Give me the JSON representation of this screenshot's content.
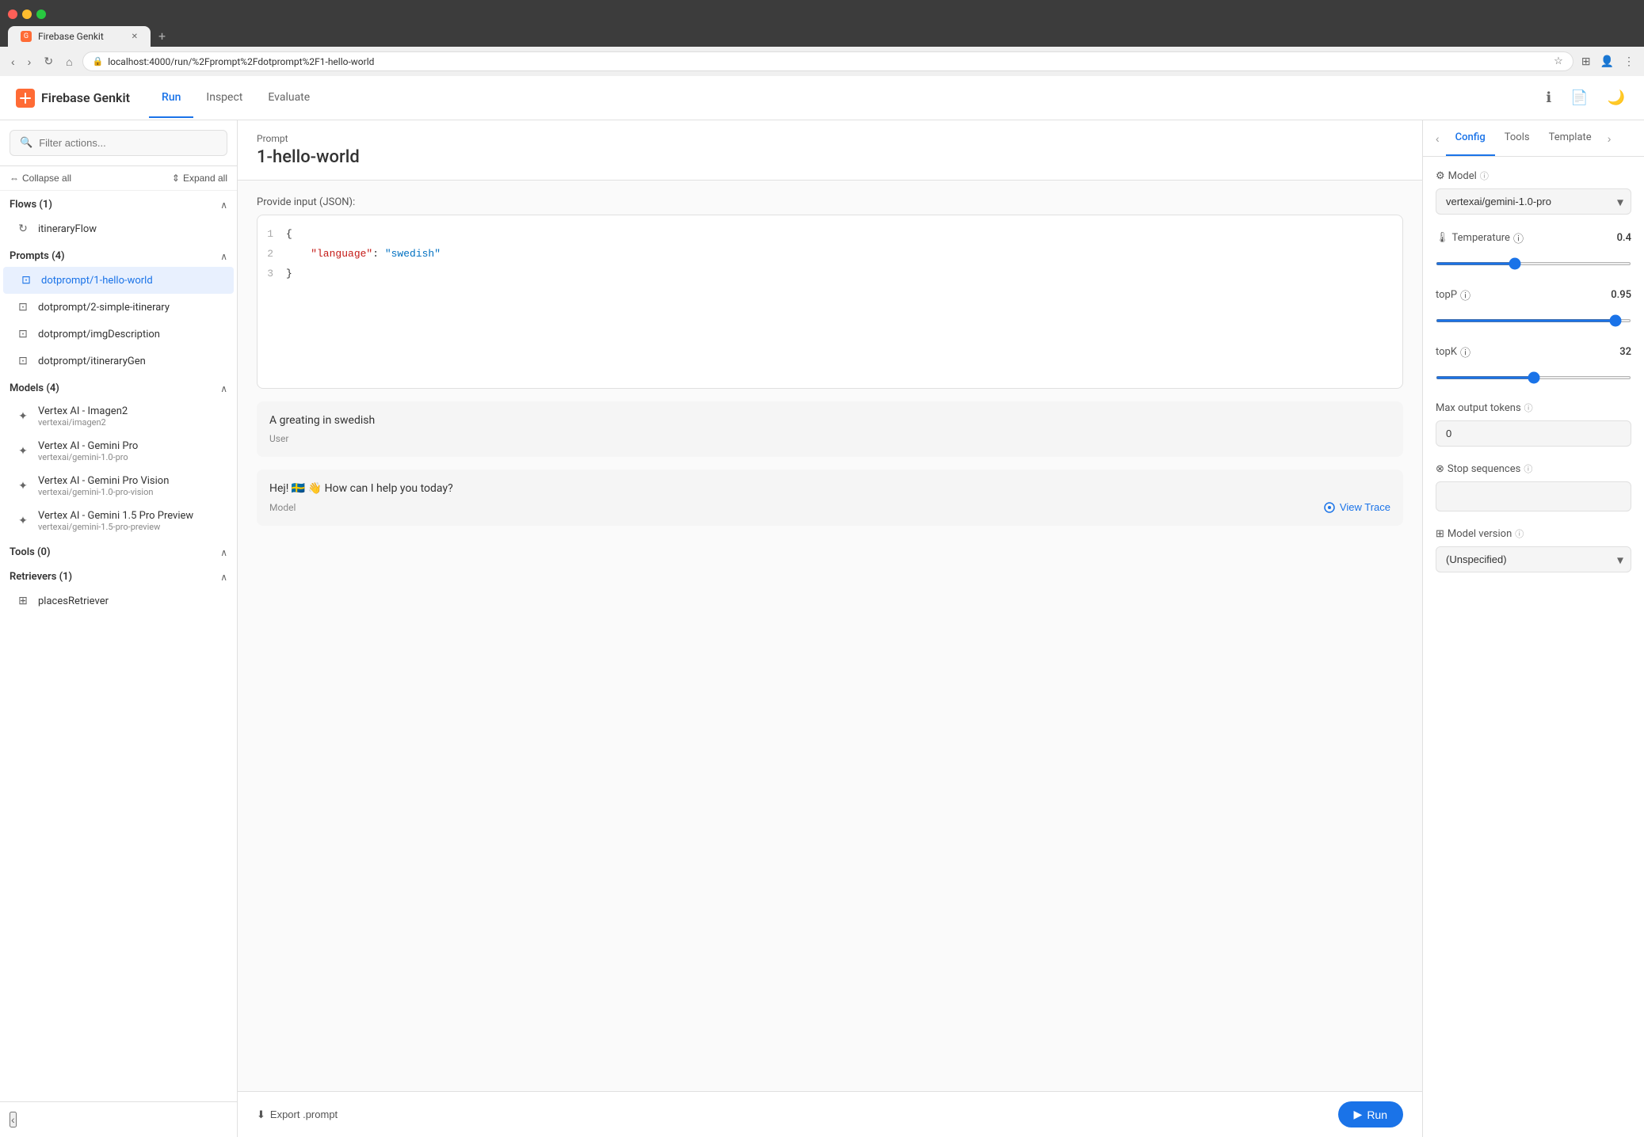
{
  "browser": {
    "tab_label": "Firebase Genkit",
    "tab_close": "✕",
    "tab_new": "+",
    "url": "localhost:4000/run/%2Fprompt%2Fdotprompt%2F1-hello-world",
    "nav_back": "‹",
    "nav_forward": "›",
    "nav_refresh": "↻",
    "nav_home": "⌂"
  },
  "header": {
    "logo_text": "Firebase Genkit",
    "nav_run": "Run",
    "nav_inspect": "Inspect",
    "nav_evaluate": "Evaluate"
  },
  "sidebar": {
    "search_placeholder": "Filter actions...",
    "collapse_all": "Collapse all",
    "expand_all": "Expand all",
    "sections": [
      {
        "title": "Flows (1)",
        "items": [
          {
            "label": "itineraryFlow",
            "icon": "flow"
          }
        ]
      },
      {
        "title": "Prompts (4)",
        "items": [
          {
            "label": "dotprompt/1-hello-world",
            "icon": "prompt",
            "active": true
          },
          {
            "label": "dotprompt/2-simple-itinerary",
            "icon": "prompt"
          },
          {
            "label": "dotprompt/imgDescription",
            "icon": "prompt"
          },
          {
            "label": "dotprompt/itineraryGen",
            "icon": "prompt"
          }
        ]
      },
      {
        "title": "Models (4)",
        "items": [
          {
            "label": "Vertex AI - Imagen2",
            "sublabel": "vertexai/imagen2",
            "icon": "model"
          },
          {
            "label": "Vertex AI - Gemini Pro",
            "sublabel": "vertexai/gemini-1.0-pro",
            "icon": "model"
          },
          {
            "label": "Vertex AI - Gemini Pro Vision",
            "sublabel": "vertexai/gemini-1.0-pro-vision",
            "icon": "model"
          },
          {
            "label": "Vertex AI - Gemini 1.5 Pro Preview",
            "sublabel": "vertexai/gemini-1.5-pro-preview",
            "icon": "model"
          }
        ]
      },
      {
        "title": "Tools (0)",
        "items": []
      },
      {
        "title": "Retrievers (1)",
        "items": [
          {
            "label": "placesRetriever",
            "icon": "retriever"
          }
        ]
      }
    ],
    "collapse_icon": "‹"
  },
  "prompt": {
    "breadcrumb": "Prompt",
    "title": "1-hello-world",
    "input_label": "Provide input (JSON):",
    "code_lines": [
      {
        "num": "1",
        "content": "{",
        "type": "brace"
      },
      {
        "num": "2",
        "content": "  \"language\": \"swedish\"",
        "type": "keyvalue",
        "key": "\"language\"",
        "value": "\"swedish\""
      },
      {
        "num": "3",
        "content": "}",
        "type": "brace"
      }
    ]
  },
  "messages": [
    {
      "text": "A greating in swedish",
      "role": "User",
      "type": "user"
    },
    {
      "text": "Hej! 🇸🇪 👋 How can I help you today?",
      "role": "Model",
      "type": "model",
      "has_trace": true
    }
  ],
  "footer": {
    "export_label": "Export .prompt",
    "run_label": "Run"
  },
  "right_panel": {
    "nav_prev": "‹",
    "nav_next": "›",
    "tabs": [
      "Config",
      "Tools",
      "Template"
    ],
    "active_tab": "Config",
    "config": {
      "model_label": "Model",
      "model_value": "vertexai/gemini-1.0-pro",
      "temperature_label": "Temperature",
      "temperature_value": "0.4",
      "temperature_min": 0,
      "temperature_max": 1,
      "temperature_current": 0.4,
      "topp_label": "topP",
      "topp_value": "0.95",
      "topp_min": 0,
      "topp_max": 1,
      "topp_current": 0.95,
      "topk_label": "topK",
      "topk_value": "32",
      "topk_min": 0,
      "topk_max": 64,
      "topk_current": 32,
      "max_tokens_label": "Max output tokens",
      "max_tokens_value": "0",
      "stop_sequences_label": "Stop sequences",
      "stop_sequences_value": "",
      "model_version_label": "Model version",
      "model_version_value": "(Unspecified)"
    }
  },
  "view_trace_label": "View Trace"
}
